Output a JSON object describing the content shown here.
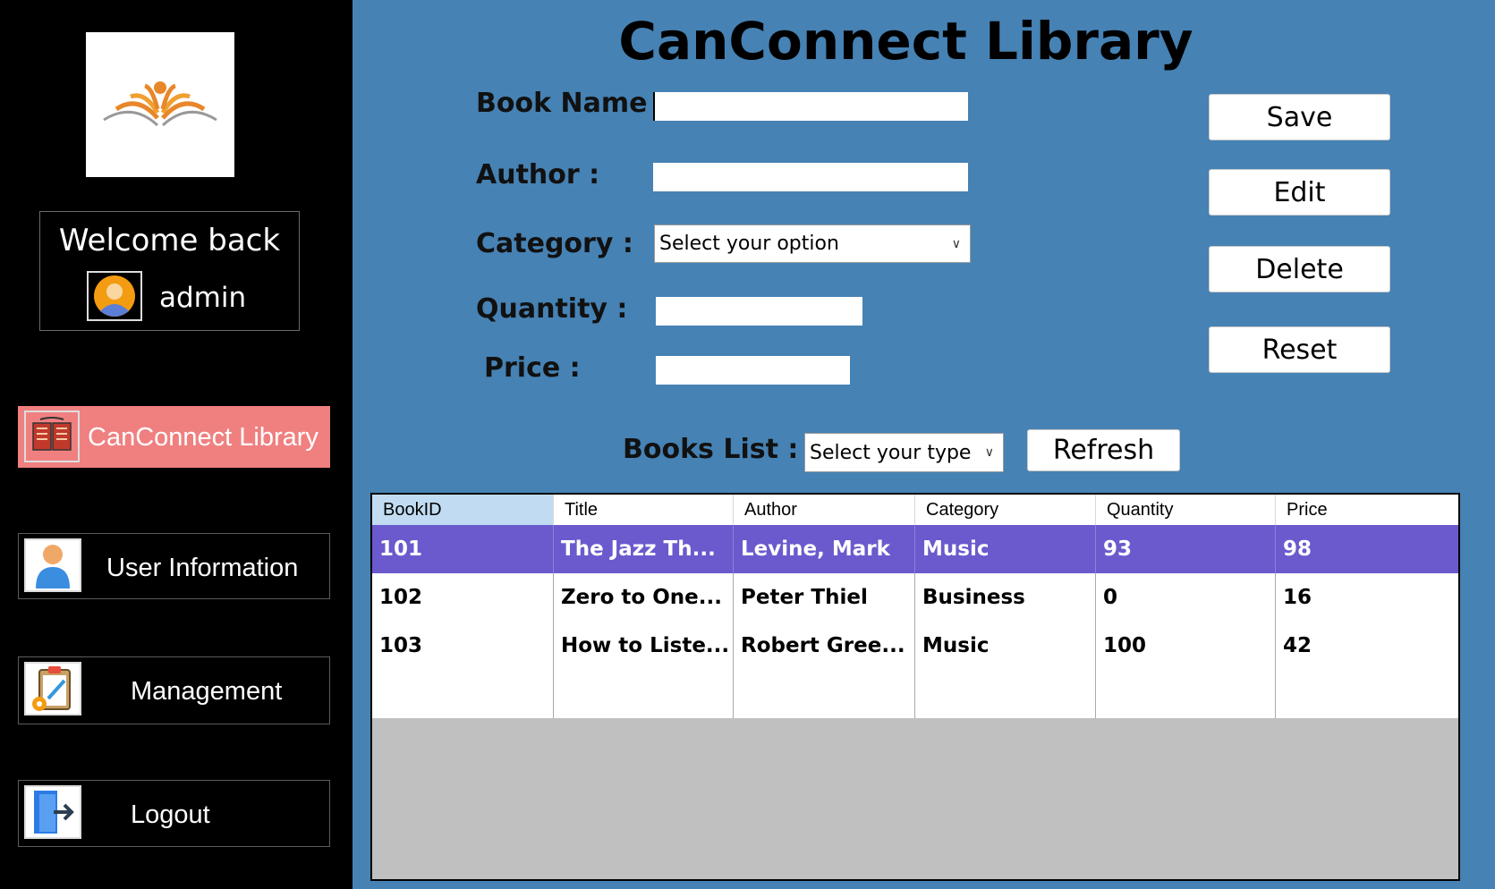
{
  "sidebar": {
    "welcome_text": "Welcome back",
    "username": "admin",
    "nav": [
      {
        "label": "CanConnect Library",
        "active": true
      },
      {
        "label": "User Information",
        "active": false
      },
      {
        "label": "Management",
        "active": false
      },
      {
        "label": "Logout",
        "active": false
      }
    ]
  },
  "main": {
    "title": "CanConnect Library",
    "form": {
      "book_name_label": "Book Name :",
      "author_label": "Author :",
      "category_label": "Category :",
      "category_selected": "Select your option",
      "quantity_label": "Quantity :",
      "price_label": "Price :",
      "book_name_value": "",
      "author_value": "",
      "quantity_value": "",
      "price_value": ""
    },
    "buttons": {
      "save": "Save",
      "edit": "Edit",
      "delete": "Delete",
      "reset": "Reset",
      "refresh": "Refresh"
    },
    "books_list_label": "Books List :",
    "books_list_selected": "Select your type",
    "table": {
      "columns": [
        "BookID",
        "Title",
        "Author",
        "Category",
        "Quantity",
        "Price"
      ],
      "rows": [
        [
          "101",
          "The Jazz Th...",
          "Levine, Mark",
          "Music",
          "93",
          "98"
        ],
        [
          "102",
          "Zero to One...",
          "Peter Thiel",
          "Business",
          "0",
          "16"
        ],
        [
          "103",
          "How to Liste...",
          "Robert Gree...",
          "Music",
          "100",
          "42"
        ]
      ],
      "selected_row": 0
    }
  },
  "colors": {
    "main_bg": "#4682b4",
    "active_nav": "#f08080",
    "selected_row": "#6a5acd",
    "header_selected": "#c1dcf2"
  }
}
